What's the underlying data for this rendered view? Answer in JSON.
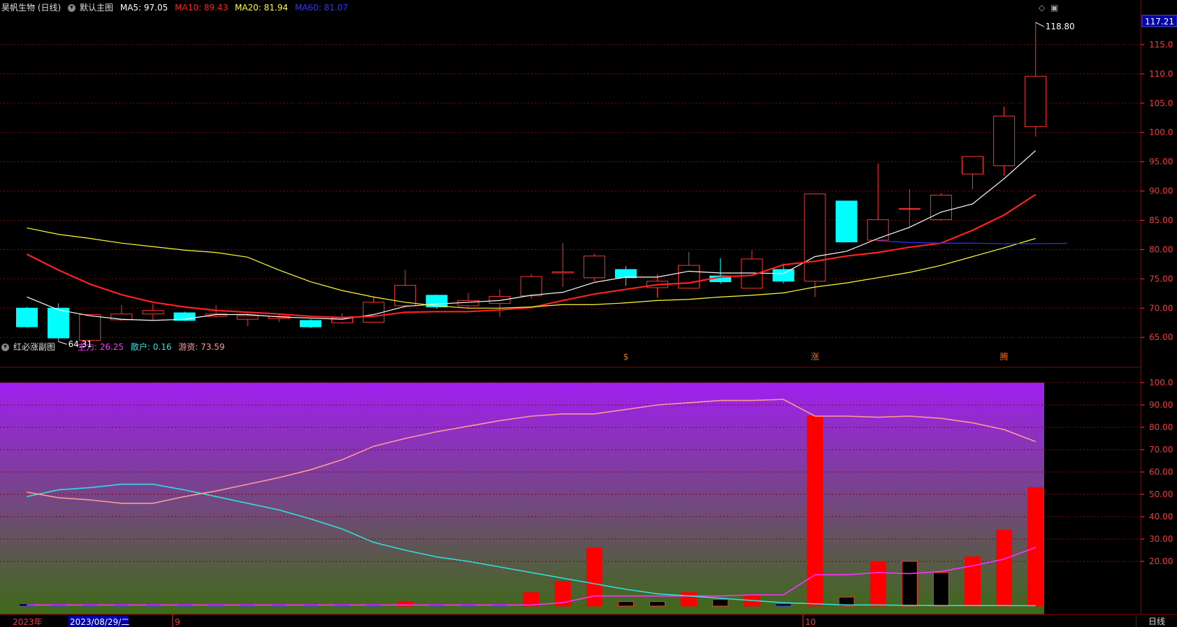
{
  "header": {
    "stock_title": "昊帆生物 (日线)",
    "main_chart_label": "默认主图",
    "ma5": {
      "label": "MA5: 97.05",
      "color": "#ffffff"
    },
    "ma10": {
      "label": "MA10: 89.43",
      "color": "#ff2020"
    },
    "ma20": {
      "label": "MA20: 81.94",
      "color": "#ffff33"
    },
    "ma60": {
      "label": "MA60: 81.07",
      "color": "#3333ff"
    }
  },
  "sub_header": {
    "title": "红必涨副图",
    "zhuli": {
      "label": "主力: 26.25",
      "color": "#ff33ff"
    },
    "sanhu": {
      "label": "散户: 0.16",
      "color": "#33dddd"
    },
    "youzi": {
      "label": "游资: 73.59",
      "color": "#ff9999"
    }
  },
  "footer": {
    "year_label": "2023年",
    "date_cursor": "2023/08/29/二",
    "month_sep": "9",
    "month_oct": "10",
    "tab_daily": "日线"
  },
  "price_axis": {
    "ticks": [
      "115.0",
      "110.0",
      "105.0",
      "100.0",
      "95.00",
      "90.00",
      "85.00",
      "80.00",
      "75.00",
      "70.00",
      "65.00"
    ],
    "current_price": "117.21",
    "high_label": "118.80",
    "low_label": "64.31"
  },
  "sub_axis": {
    "ticks": [
      "100.0",
      "90.00",
      "80.00",
      "70.00",
      "60.00",
      "50.00",
      "40.00",
      "30.00",
      "20.00"
    ]
  },
  "markers": [
    "$",
    "涨",
    "腾"
  ],
  "colors": {
    "up": "#ff3333",
    "down": "#00ffff",
    "grid": "#8b0000",
    "axis_text": "#ff3333"
  },
  "chart_data": [
    {
      "type": "candlestick",
      "title": "昊帆生物 (日线)",
      "ylim": [
        63,
        120
      ],
      "candles": [
        {
          "o": 70.0,
          "h": 70.2,
          "l": 66.7,
          "c": 66.8
        },
        {
          "o": 70.0,
          "h": 70.8,
          "l": 64.3,
          "c": 64.9
        },
        {
          "o": 64.5,
          "h": 69.0,
          "l": 64.3,
          "c": 68.9
        },
        {
          "o": 68.0,
          "h": 70.5,
          "l": 67.8,
          "c": 69.0
        },
        {
          "o": 69.0,
          "h": 70.7,
          "l": 68.0,
          "c": 69.6
        },
        {
          "o": 69.2,
          "h": 69.4,
          "l": 67.8,
          "c": 67.9
        },
        {
          "o": 68.6,
          "h": 70.5,
          "l": 68.4,
          "c": 69.0
        },
        {
          "o": 68.1,
          "h": 69.1,
          "l": 66.9,
          "c": 68.7
        },
        {
          "o": 68.2,
          "h": 69.0,
          "l": 67.6,
          "c": 68.6
        },
        {
          "o": 67.9,
          "h": 68.1,
          "l": 66.6,
          "c": 66.8
        },
        {
          "o": 67.5,
          "h": 69.1,
          "l": 67.3,
          "c": 68.3
        },
        {
          "o": 67.6,
          "h": 72.0,
          "l": 67.5,
          "c": 71.0
        },
        {
          "o": 70.4,
          "h": 76.5,
          "l": 70.1,
          "c": 73.9
        },
        {
          "o": 72.2,
          "h": 72.3,
          "l": 69.9,
          "c": 70.2
        },
        {
          "o": 70.4,
          "h": 72.6,
          "l": 70.1,
          "c": 71.3
        },
        {
          "o": 70.8,
          "h": 73.2,
          "l": 68.5,
          "c": 72.0
        },
        {
          "o": 72.1,
          "h": 75.8,
          "l": 71.6,
          "c": 75.4
        },
        {
          "o": 76.0,
          "h": 81.1,
          "l": 73.6,
          "c": 76.2
        },
        {
          "o": 75.2,
          "h": 79.3,
          "l": 74.6,
          "c": 78.9
        },
        {
          "o": 76.6,
          "h": 77.2,
          "l": 73.8,
          "c": 75.2
        },
        {
          "o": 73.5,
          "h": 75.8,
          "l": 71.8,
          "c": 74.6
        },
        {
          "o": 73.4,
          "h": 79.6,
          "l": 73.3,
          "c": 77.3
        },
        {
          "o": 75.5,
          "h": 78.5,
          "l": 74.2,
          "c": 74.5
        },
        {
          "o": 73.4,
          "h": 79.9,
          "l": 73.3,
          "c": 78.4
        },
        {
          "o": 76.6,
          "h": 77.6,
          "l": 74.2,
          "c": 74.6
        },
        {
          "o": 74.6,
          "h": 89.6,
          "l": 71.9,
          "c": 89.5
        },
        {
          "o": 88.3,
          "h": 88.3,
          "l": 81.2,
          "c": 81.3
        },
        {
          "o": 81.6,
          "h": 94.7,
          "l": 81.3,
          "c": 85.1
        },
        {
          "o": 87.0,
          "h": 90.3,
          "l": 83.9,
          "c": 87.0
        },
        {
          "o": 85.1,
          "h": 89.6,
          "l": 84.9,
          "c": 89.3
        },
        {
          "o": 92.9,
          "h": 93.5,
          "l": 90.3,
          "c": 95.9
        },
        {
          "o": 94.3,
          "h": 104.4,
          "l": 92.6,
          "c": 102.8
        },
        {
          "o": 101.0,
          "h": 118.8,
          "l": 99.3,
          "c": 109.6
        }
      ],
      "series": [
        {
          "name": "MA5",
          "values": [
            71.9,
            69.7,
            68.7,
            68.1,
            67.9,
            68.1,
            68.9,
            68.9,
            68.5,
            68.3,
            68.1,
            68.9,
            70.3,
            70.7,
            71.0,
            71.3,
            72.2,
            72.7,
            74.4,
            75.3,
            75.3,
            76.3,
            76.0,
            76.0,
            75.9,
            78.8,
            79.7,
            81.9,
            83.8,
            86.4,
            87.8,
            92.1,
            96.9
          ]
        },
        {
          "name": "MA10",
          "values": [
            79.2,
            76.5,
            74.1,
            72.3,
            71.0,
            70.2,
            69.6,
            69.3,
            69.0,
            68.6,
            68.4,
            68.6,
            69.3,
            69.4,
            69.4,
            69.7,
            70.1,
            71.3,
            72.4,
            73.2,
            74.0,
            74.3,
            75.3,
            75.6,
            77.4,
            78.0,
            78.9,
            79.5,
            80.4,
            81.1,
            83.3,
            85.9,
            89.4
          ]
        },
        {
          "name": "MA20",
          "values": [
            83.7,
            82.6,
            81.9,
            81.1,
            80.5,
            79.9,
            79.5,
            78.7,
            76.5,
            74.5,
            73.0,
            71.9,
            71.0,
            70.4,
            70.0,
            70.0,
            70.2,
            70.6,
            70.6,
            70.9,
            71.3,
            71.5,
            71.9,
            72.2,
            72.6,
            73.6,
            74.3,
            75.2,
            76.1,
            77.3,
            78.8,
            80.3,
            81.9
          ]
        },
        {
          "name": "MA60",
          "start_index": 27,
          "values": [
            81.5,
            81.2,
            81.1,
            81.1,
            81.0,
            81.0,
            81.07
          ]
        }
      ]
    },
    {
      "type": "bar+line",
      "title": "红必涨副图",
      "ylim": [
        0,
        100
      ],
      "bars": [
        1,
        1,
        1,
        1,
        1,
        1,
        1,
        1,
        1,
        1,
        1,
        1,
        2,
        1,
        1,
        1,
        6,
        11,
        26,
        2,
        2,
        6,
        3,
        5,
        1,
        85,
        4,
        20,
        20,
        15,
        22,
        34,
        53
      ],
      "series": [
        {
          "name": "主力",
          "values": [
            0.5,
            0.5,
            0.5,
            0.5,
            0.5,
            0.5,
            0.5,
            0.5,
            0.5,
            0.5,
            0.5,
            0.5,
            0.5,
            0.5,
            0.5,
            0.5,
            0.5,
            1.5,
            4.5,
            4.5,
            4.5,
            4.5,
            4.5,
            5,
            5,
            14,
            14,
            15,
            14.5,
            15.5,
            18,
            21,
            26.25
          ]
        },
        {
          "name": "散户",
          "values": [
            49,
            52,
            53,
            54.5,
            54.5,
            52,
            49,
            46,
            43,
            39,
            34.5,
            28.5,
            25,
            22,
            20,
            17.5,
            15,
            12.5,
            10,
            7.5,
            5.5,
            4.5,
            3.5,
            2.5,
            1.5,
            1,
            0.5,
            0.5,
            0.3,
            0.2,
            0.2,
            0.2,
            0.16
          ]
        },
        {
          "name": "游资",
          "values": [
            51,
            48.5,
            47.5,
            46,
            46,
            49,
            51.5,
            54.5,
            57.5,
            61,
            65.5,
            71.5,
            75,
            78,
            80.5,
            83,
            85,
            86,
            86,
            88,
            90,
            91,
            92,
            92,
            92.5,
            85,
            85,
            84.5,
            85,
            84,
            82,
            79,
            73.59
          ]
        }
      ]
    }
  ]
}
